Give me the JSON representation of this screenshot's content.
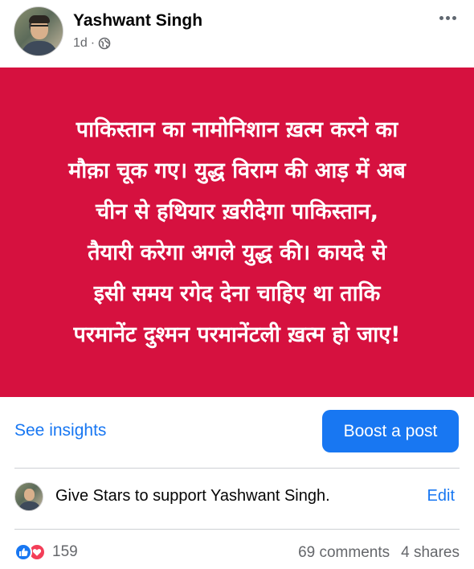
{
  "post": {
    "author": "Yashwant Singh",
    "time": "1d",
    "separator": "·",
    "privacy_icon": "globe-icon",
    "more_icon": "more-horizontal-icon"
  },
  "banner": {
    "background_color": "#d6113f",
    "text_color": "#ffffff",
    "lines": [
      "पाकिस्तान का नामोनिशान ख़त्म करने का",
      "मौक़ा चूक गए। युद्ध विराम की आड़ में अब",
      "चीन से हथियार ख़रीदेगा पाकिस्तान,",
      "तैयारी करेगा अगले युद्ध की। कायदे से",
      "इसी समय रगेद देना चाहिए था ताकि",
      "परमानेंट दुश्मन परमानेंटली ख़त्म हो जाए!"
    ]
  },
  "actions": {
    "insights_label": "See insights",
    "boost_label": "Boost a post",
    "accent_color": "#1877f2"
  },
  "stars": {
    "text": "Give Stars to support Yashwant Singh.",
    "edit_label": "Edit"
  },
  "stats": {
    "reaction_icons": [
      "like-icon",
      "love-icon"
    ],
    "reaction_count": "159",
    "comments": "69 comments",
    "shares": "4 shares"
  }
}
